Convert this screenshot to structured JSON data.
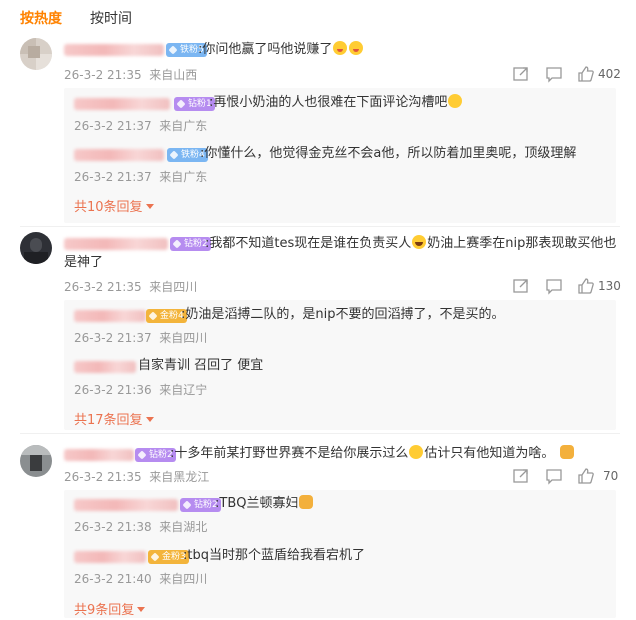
{
  "tabs": {
    "hot": "按热度",
    "time": "按时间"
  },
  "comments": [
    {
      "badge": "铁粉5",
      "text": ":你问他赢了吗他说赚了",
      "time": "26-3-2 21:35",
      "location": "来自山西",
      "likes": "402",
      "replies": [
        {
          "badge": "钻粉1",
          "text": ":再恨小奶油的人也很难在下面评论沟槽吧",
          "time": "26-3-2 21:37",
          "location": "来自广东"
        },
        {
          "badge": "铁粉4",
          "text": ":你懂什么，他觉得金克丝不会a他，所以防着加里奥呢，顶级理解",
          "time": "26-3-2 21:37",
          "location": "来自广东"
        }
      ],
      "more": "共10条回复"
    },
    {
      "badge": "钻粉2",
      "text_line1": ":我都不知道tes现在是谁在负责买人",
      "text_line1b": "奶油上赛季在nip那表现敢买他也",
      "text_line2": "是神了",
      "time": "26-3-2 21:35",
      "location": "来自四川",
      "likes": "130",
      "replies": [
        {
          "badge": "金粉4",
          "text": ":奶油是滔搏二队的，是nip不要的回滔搏了，不是买的。",
          "time": "26-3-2 21:37",
          "location": "来自四川"
        },
        {
          "badge": "",
          "text": "自家青训 召回了 便宜",
          "time": "26-3-2 21:36",
          "location": "来自辽宁"
        }
      ],
      "more": "共17条回复"
    },
    {
      "badge": "钻粉2",
      "text": ":十多年前某打野世界赛不是给你展示过么",
      "text_b": "估计只有他知道为啥。",
      "time": "26-3-2 21:35",
      "location": "来自黑龙江",
      "likes": "70",
      "replies": [
        {
          "badge": "钻粉2",
          "text": ":TBQ兰顿寡妇",
          "time": "26-3-2 21:38",
          "location": "来自湖北"
        },
        {
          "badge": "金粉3",
          "text": ":tbq当时那个蓝盾给我看宕机了",
          "time": "26-3-2 21:40",
          "location": "来自四川"
        }
      ],
      "more": "共9条回复"
    }
  ],
  "colors": {
    "accent": "#ff8200",
    "more_link": "#eb7350",
    "meta": "#999999"
  },
  "icons": [
    "share-icon",
    "comment-icon",
    "like-icon"
  ]
}
